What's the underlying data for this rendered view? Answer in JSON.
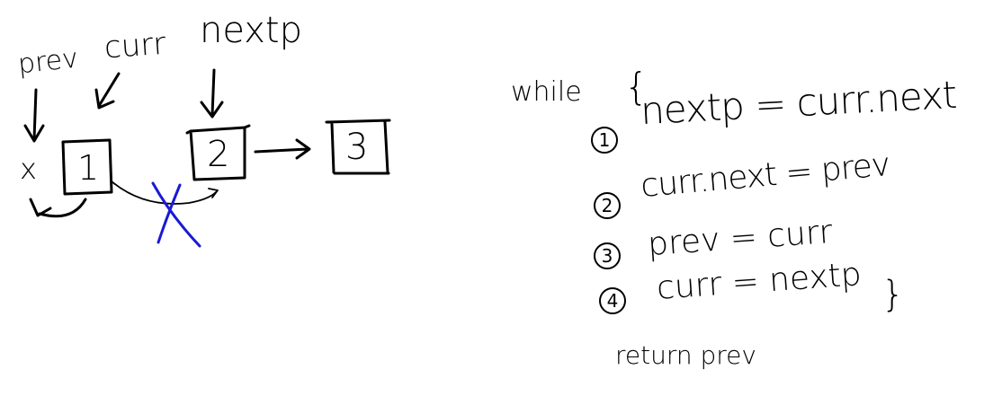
{
  "diagram": {
    "pointers": {
      "prev": "prev",
      "curr": "curr",
      "nextp": "nextp"
    },
    "null_mark": "x",
    "nodes": [
      "1",
      "2",
      "3"
    ],
    "broken_link_color": "#1a1ad4"
  },
  "code": {
    "while_keyword": "while",
    "open_brace": "{",
    "steps": [
      {
        "num": "1",
        "text": "nextp = curr.next"
      },
      {
        "num": "2",
        "text": "curr.next = prev"
      },
      {
        "num": "3",
        "text": "prev = curr"
      },
      {
        "num": "4",
        "text": "curr = nextp"
      }
    ],
    "close_brace": "}",
    "return_text": "return prev"
  }
}
